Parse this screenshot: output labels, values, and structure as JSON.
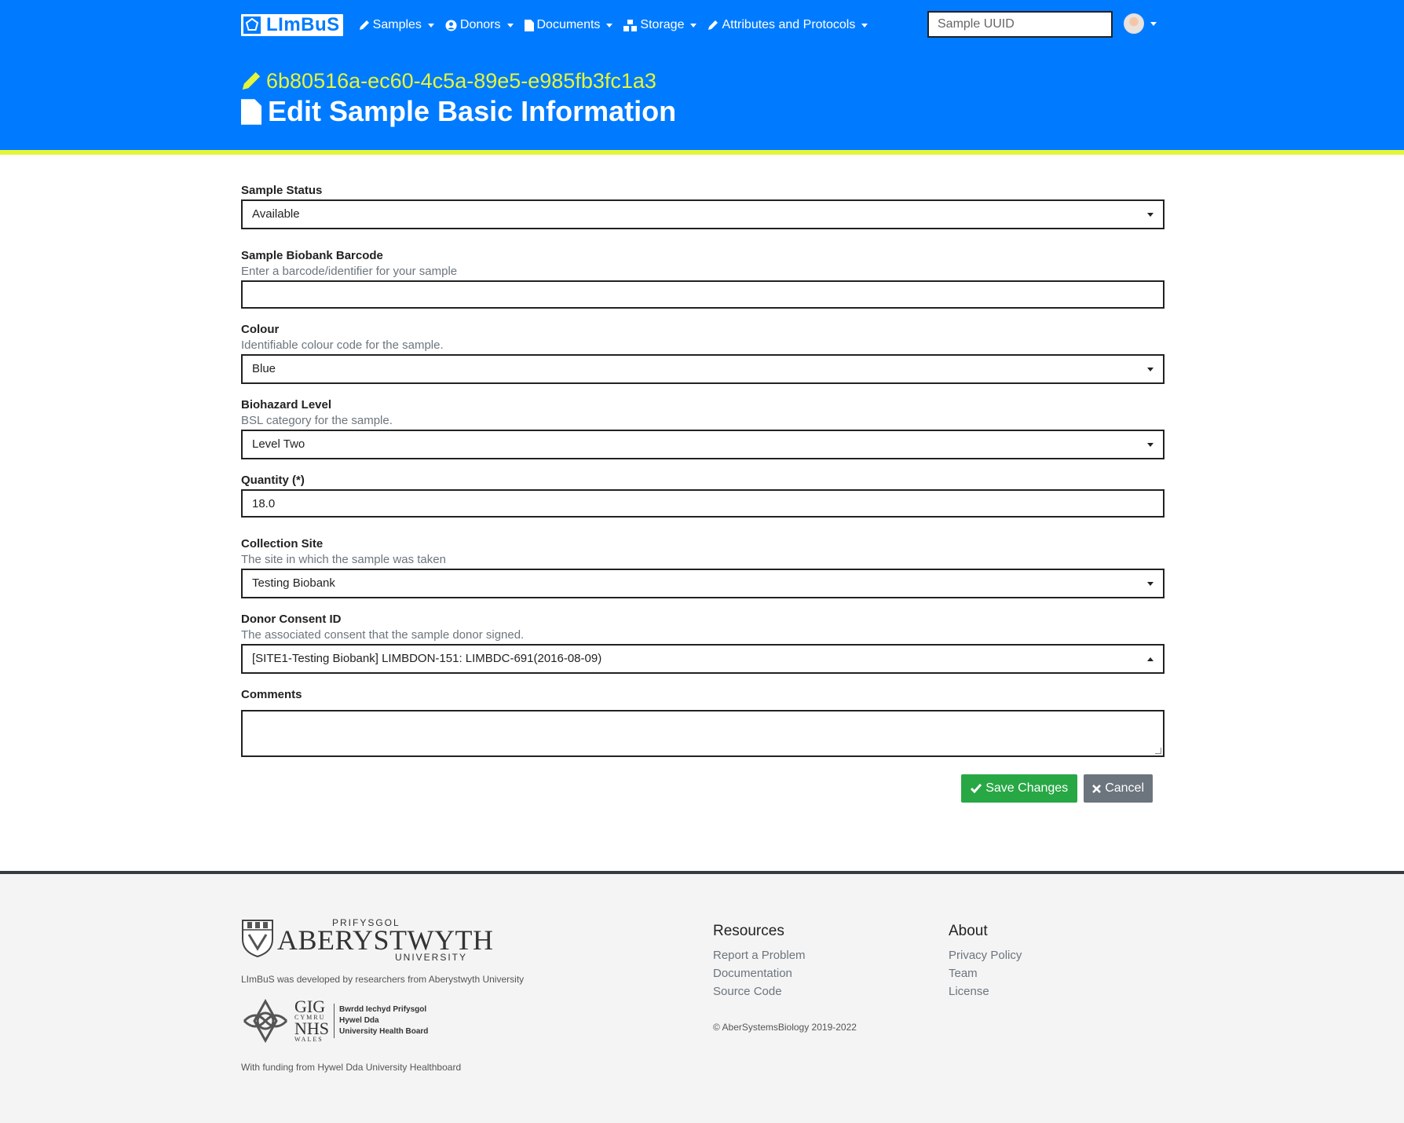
{
  "app": {
    "brand": "LImBuS"
  },
  "nav": {
    "items": [
      {
        "label": "Samples",
        "icon": "pencil-icon"
      },
      {
        "label": "Donors",
        "icon": "user-circle-icon"
      },
      {
        "label": "Documents",
        "icon": "file-icon"
      },
      {
        "label": "Storage",
        "icon": "boxes-icon"
      },
      {
        "label": "Attributes and Protocols",
        "icon": "pencil-icon"
      }
    ],
    "search_placeholder": "Sample UUID"
  },
  "page": {
    "uuid": "6b80516a-ec60-4c5a-89e5-e985fb3fc1a3",
    "title": "Edit Sample Basic Information"
  },
  "form": {
    "sample_status": {
      "label": "Sample Status",
      "value": "Available"
    },
    "barcode": {
      "label": "Sample Biobank Barcode",
      "help": "Enter a barcode/identifier for your sample",
      "value": ""
    },
    "colour": {
      "label": "Colour",
      "help": "Identifiable colour code for the sample.",
      "value": "Blue"
    },
    "biohazard": {
      "label": "Biohazard Level",
      "help": "BSL category for the sample.",
      "value": "Level Two"
    },
    "quantity": {
      "label": "Quantity (*)",
      "value": "18.0"
    },
    "collection_site": {
      "label": "Collection Site",
      "help": "The site in which the sample was taken",
      "value": "Testing Biobank"
    },
    "consent": {
      "label": "Donor Consent ID",
      "help": "The associated consent that the sample donor signed.",
      "value": "[SITE1-Testing Biobank] LIMBDON-151: LIMBDC-691(2016-08-09)"
    },
    "comments": {
      "label": "Comments",
      "value": ""
    },
    "save_label": "Save Changes",
    "cancel_label": "Cancel"
  },
  "footer": {
    "uni_small": "PRIFYSGOL",
    "uni_name": "ABERYSTWYTH",
    "uni_small2": "UNIVERSITY",
    "developed_by": "LImBuS was developed by researchers from Aberystwyth University",
    "nhs_gig": "GIG",
    "nhs_cymru": "CYMRU",
    "nhs_nhs": "NHS",
    "nhs_wales": "WALES",
    "nhs_board_1": "Bwrdd Iechyd Prifysgol",
    "nhs_board_2": "Hywel Dda",
    "nhs_board_3": "University Health Board",
    "funding": "With funding from Hywel Dda University Healthboard",
    "resources_title": "Resources",
    "resources": [
      "Report a Problem",
      "Documentation",
      "Source Code"
    ],
    "about_title": "About",
    "about": [
      "Privacy Policy",
      "Team",
      "License"
    ],
    "copyright": "© AberSystemsBiology 2019-2022"
  },
  "colors": {
    "primary": "#007bff",
    "accent": "#e5f53a",
    "success": "#28a745",
    "secondary": "#6c757d"
  }
}
